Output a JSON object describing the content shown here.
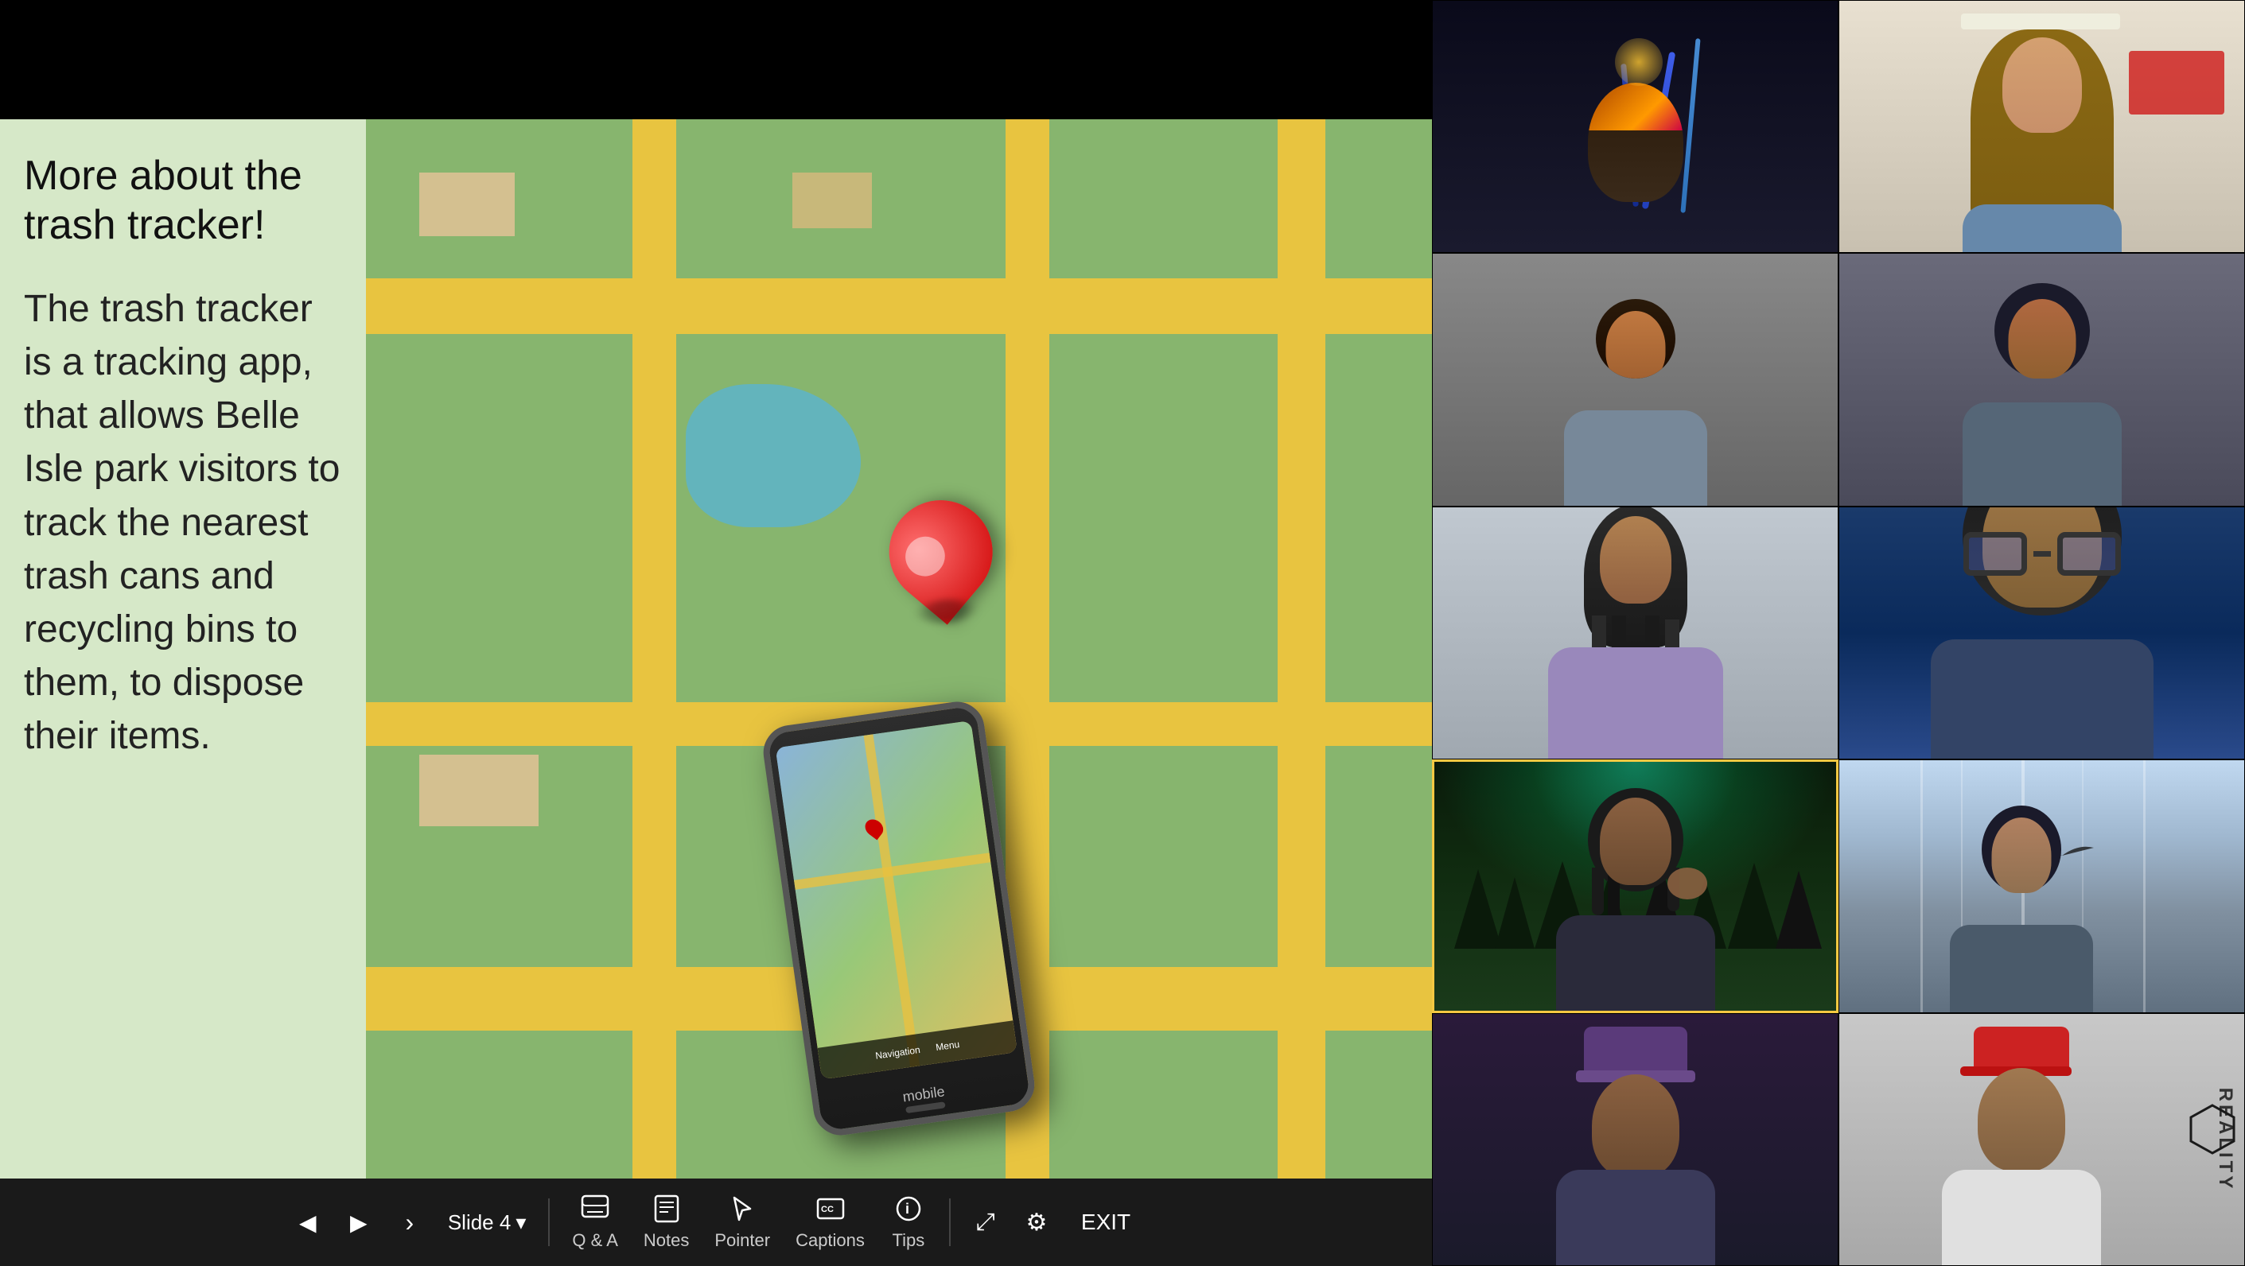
{
  "presentation": {
    "slide_title": "More about the trash tracker!",
    "slide_body": " The trash tracker is a tracking app, that allows Belle Isle park visitors to track the nearest trash cans and recycling bins to them, to dispose their items.",
    "phone_label": "mobile",
    "current_slide": "Slide 4",
    "slide_dropdown_arrow": "▾"
  },
  "toolbar": {
    "prev_label": "◀",
    "play_label": "▶",
    "cursor_label": "›",
    "qa_label": "Q & A",
    "notes_label": "Notes",
    "pointer_label": "Pointer",
    "captions_label": "Captions",
    "tips_label": "Tips",
    "expand_label": "⤢",
    "settings_label": "⚙",
    "exit_label": "EXIT"
  },
  "video_participants": [
    {
      "id": 1,
      "style": "dark-cosmic",
      "row": 1,
      "col": 1
    },
    {
      "id": 2,
      "style": "classroom",
      "row": 1,
      "col": 2
    },
    {
      "id": 3,
      "style": "gray-room",
      "row": 2,
      "col": 1
    },
    {
      "id": 4,
      "style": "gray-room-2",
      "row": 2,
      "col": 2
    },
    {
      "id": 5,
      "style": "purple-shirt",
      "row": 3,
      "col": 1
    },
    {
      "id": 6,
      "style": "blue-bg-glasses",
      "row": 3,
      "col": 2
    },
    {
      "id": 7,
      "style": "aurora-highlight",
      "row": 4,
      "col": 1,
      "highlighted": true
    },
    {
      "id": 8,
      "style": "waterfall-green",
      "row": 4,
      "col": 2
    },
    {
      "id": 9,
      "style": "purple-hat",
      "row": 5,
      "col": 1
    },
    {
      "id": 10,
      "style": "reality-text",
      "row": 5,
      "col": 2
    }
  ],
  "colors": {
    "slide_bg": "#d6e8c8",
    "toolbar_bg": "#1a1a1a",
    "highlight_border": "#f5c842",
    "text_dark": "#111111",
    "toolbar_text": "#ffffff"
  }
}
